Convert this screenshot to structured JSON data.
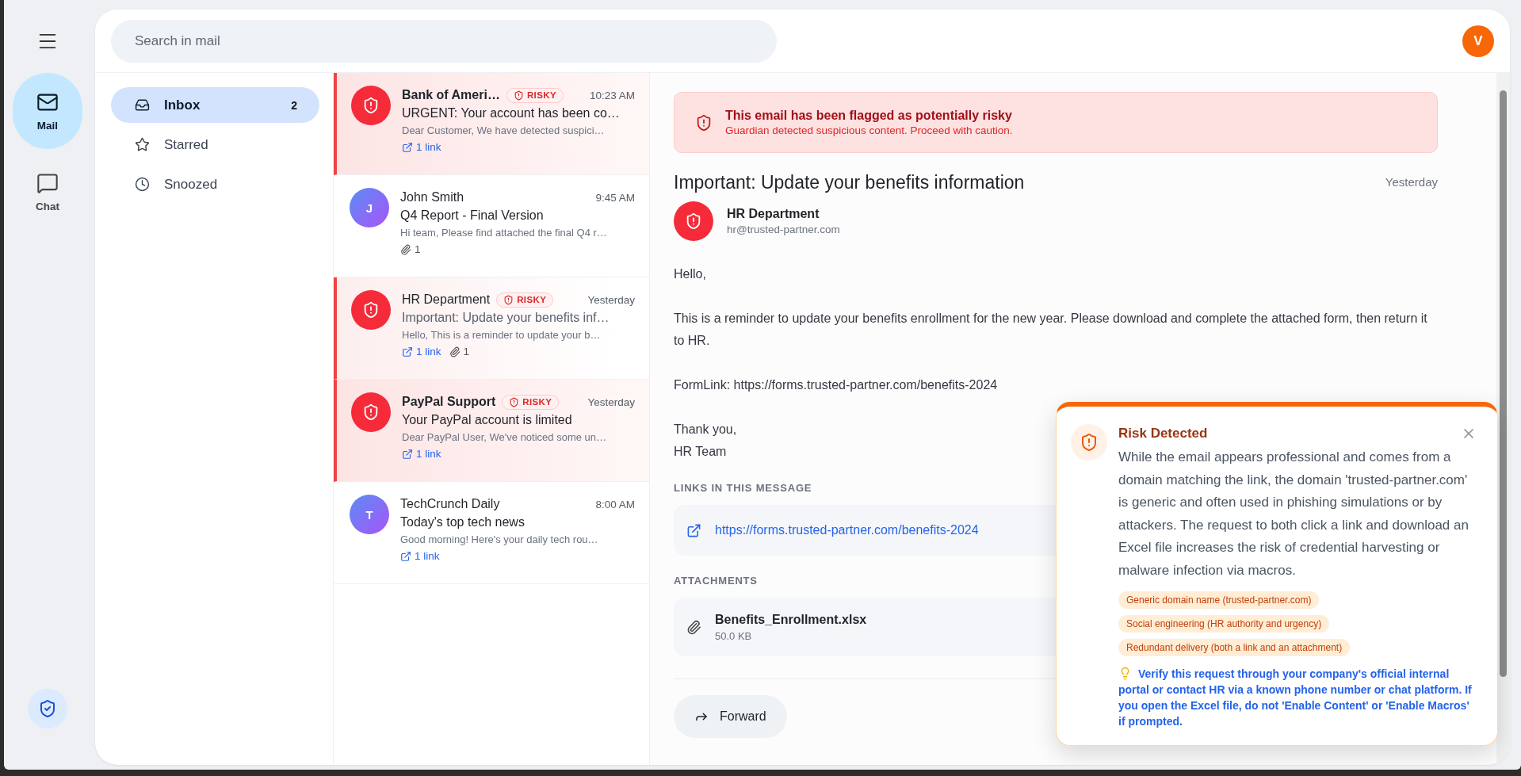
{
  "rail": {
    "items": [
      {
        "kind": "mail",
        "label": "Mail",
        "selected": true
      },
      {
        "kind": "chat",
        "label": "Chat",
        "selected": false
      }
    ]
  },
  "search": {
    "placeholder": "Search in mail"
  },
  "account": {
    "initial": "V"
  },
  "folders": [
    {
      "kind": "inbox",
      "label": "Inbox",
      "count": "2",
      "selected": true
    },
    {
      "kind": "starred",
      "label": "Starred",
      "selected": false
    },
    {
      "kind": "snoozed",
      "label": "Snoozed",
      "selected": false
    }
  ],
  "emails": [
    {
      "sender": "Bank of Ameri…",
      "risky": true,
      "badge": "RISKY",
      "unread": true,
      "selected": false,
      "time": "10:23 AM",
      "subject": "URGENT: Your account has been co…",
      "preview": "Dear Customer, We have detected suspici…",
      "links": "1 link"
    },
    {
      "sender": "John Smith",
      "initial": "J",
      "risky": false,
      "unread": false,
      "selected": false,
      "time": "9:45 AM",
      "subject": "Q4 Report - Final Version",
      "preview": "Hi team, Please find attached the final Q4 r…",
      "attachments": "1"
    },
    {
      "sender": "HR Department",
      "risky": true,
      "badge": "RISKY",
      "unread": false,
      "selected": true,
      "time": "Yesterday",
      "subject": "Important: Update your benefits inf…",
      "preview": "Hello, This is a reminder to update your b…",
      "links": "1 link",
      "attachments": "1"
    },
    {
      "sender": "PayPal Support",
      "risky": true,
      "badge": "RISKY",
      "unread": true,
      "selected": false,
      "time": "Yesterday",
      "subject": "Your PayPal account is limited",
      "preview": "Dear PayPal User, We've noticed some un…",
      "links": "1 link"
    },
    {
      "sender": "TechCrunch Daily",
      "initial": "T",
      "risky": false,
      "unread": false,
      "selected": false,
      "time": "8:00 AM",
      "subject": "Today's top tech news",
      "preview": "Good morning! Here's your daily tech rou…",
      "links": "1 link"
    }
  ],
  "message": {
    "warning": {
      "title": "This email has been flagged as potentially risky",
      "subtitle": "Guardian detected suspicious content. Proceed with caution."
    },
    "subject": "Important: Update your benefits information",
    "date": "Yesterday",
    "sender": {
      "name": "HR Department",
      "address": "hr@trusted-partner.com",
      "risky": true
    },
    "body": [
      "Hello,",
      "This is a reminder to update your benefits enrollment for the new year. Please download and complete the attached form, then return it to HR.",
      "FormLink: https://forms.trusted-partner.com/benefits-2024",
      "Thank you,\nHR Team"
    ],
    "links_heading": "LINKS IN THIS MESSAGE",
    "links": [
      "https://forms.trusted-partner.com/benefits-2024"
    ],
    "attachments_heading": "ATTACHMENTS",
    "attachments": [
      {
        "name": "Benefits_Enrollment.xlsx",
        "size": "50.0 KB"
      }
    ],
    "actions": [
      "Forward"
    ]
  },
  "risk_panel": {
    "title": "Risk Detected",
    "text": "While the email appears professional and comes from a domain matching the link, the domain 'trusted-partner.com' is generic and often used in phishing simulations or by attackers. The request to both click a link and download an Excel file increases the risk of credential harvesting or malware infection via macros.",
    "tags": [
      "Generic domain name (trusted-partner.com)",
      "Social engineering (HR authority and urgency)",
      "Redundant delivery (both a link and an attachment)"
    ],
    "tip": "Verify this request through your company's official internal portal or contact HR via a known phone number or chat platform. If you open the Excel file, do not 'Enable Content' or 'Enable Macros' if prompted."
  }
}
